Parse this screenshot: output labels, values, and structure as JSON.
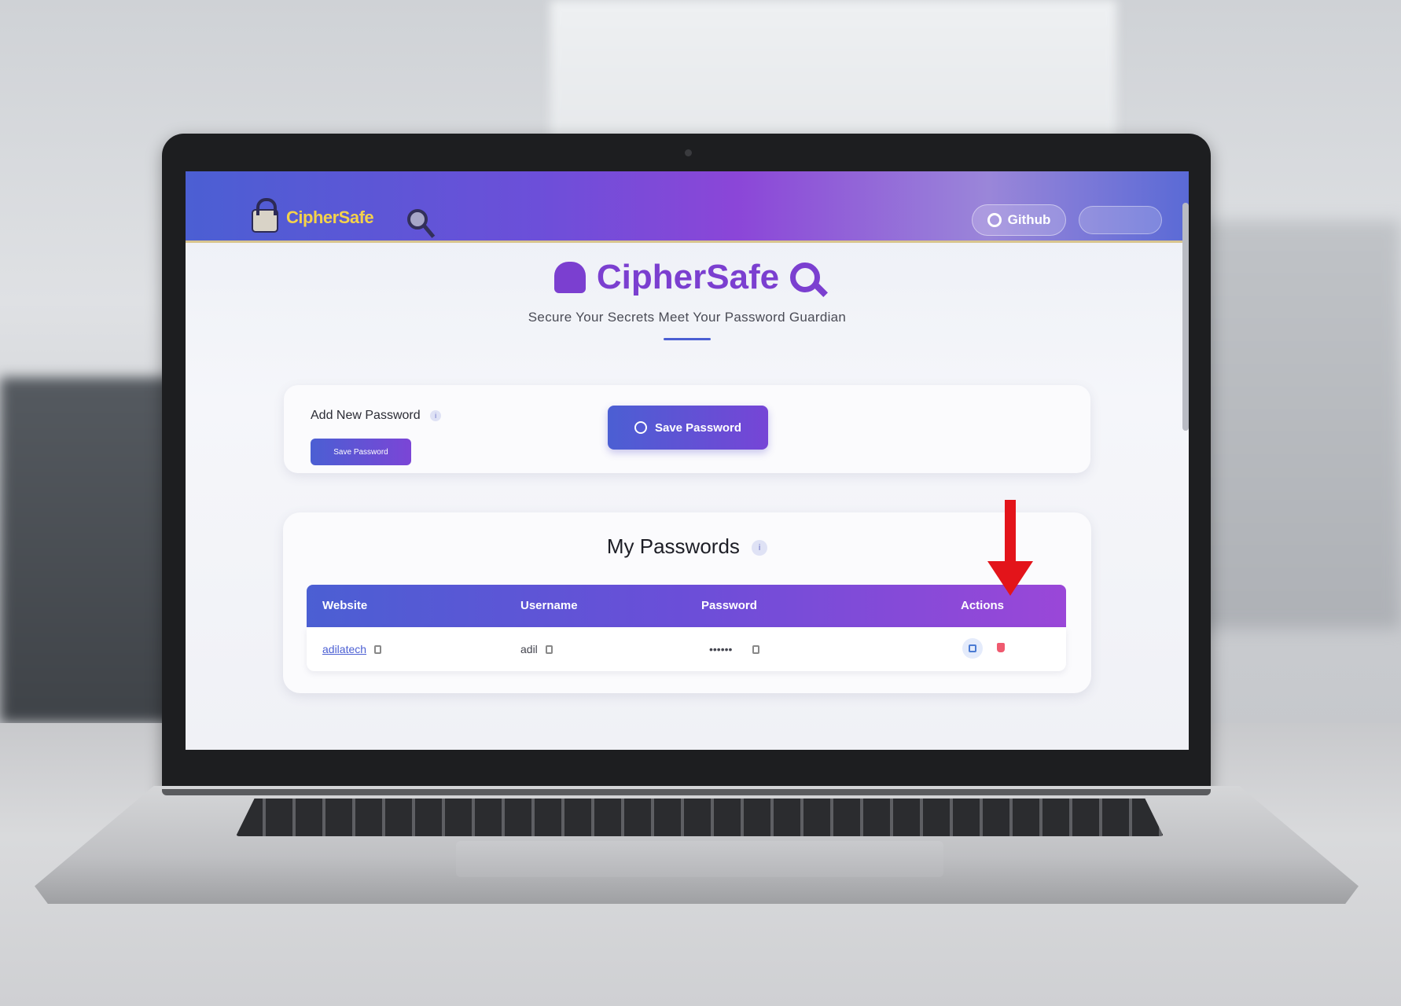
{
  "header": {
    "brand_name": "CipherSafe",
    "github_label": "Github",
    "icons": [
      "lock-icon",
      "key-icon",
      "github-icon"
    ]
  },
  "hero": {
    "title": "CipherSafe",
    "subtitle": "Secure Your Secrets Meet Your Password Guardian"
  },
  "add_card": {
    "label": "Add New Password",
    "small_button": "Save Password",
    "save_button": "Save Password"
  },
  "list_card": {
    "title": "My Passwords",
    "columns": [
      "Website",
      "Username",
      "Password",
      "Actions"
    ],
    "rows": [
      {
        "website": "adilatech",
        "username": "adil",
        "password": "••••••"
      }
    ]
  },
  "colors": {
    "accent_blue": "#4b5fd3",
    "accent_purple": "#7b3fd0",
    "brand_yellow": "#f4d24b",
    "delete_red": "#ef5a6f",
    "annotation_red": "#e3141a"
  }
}
